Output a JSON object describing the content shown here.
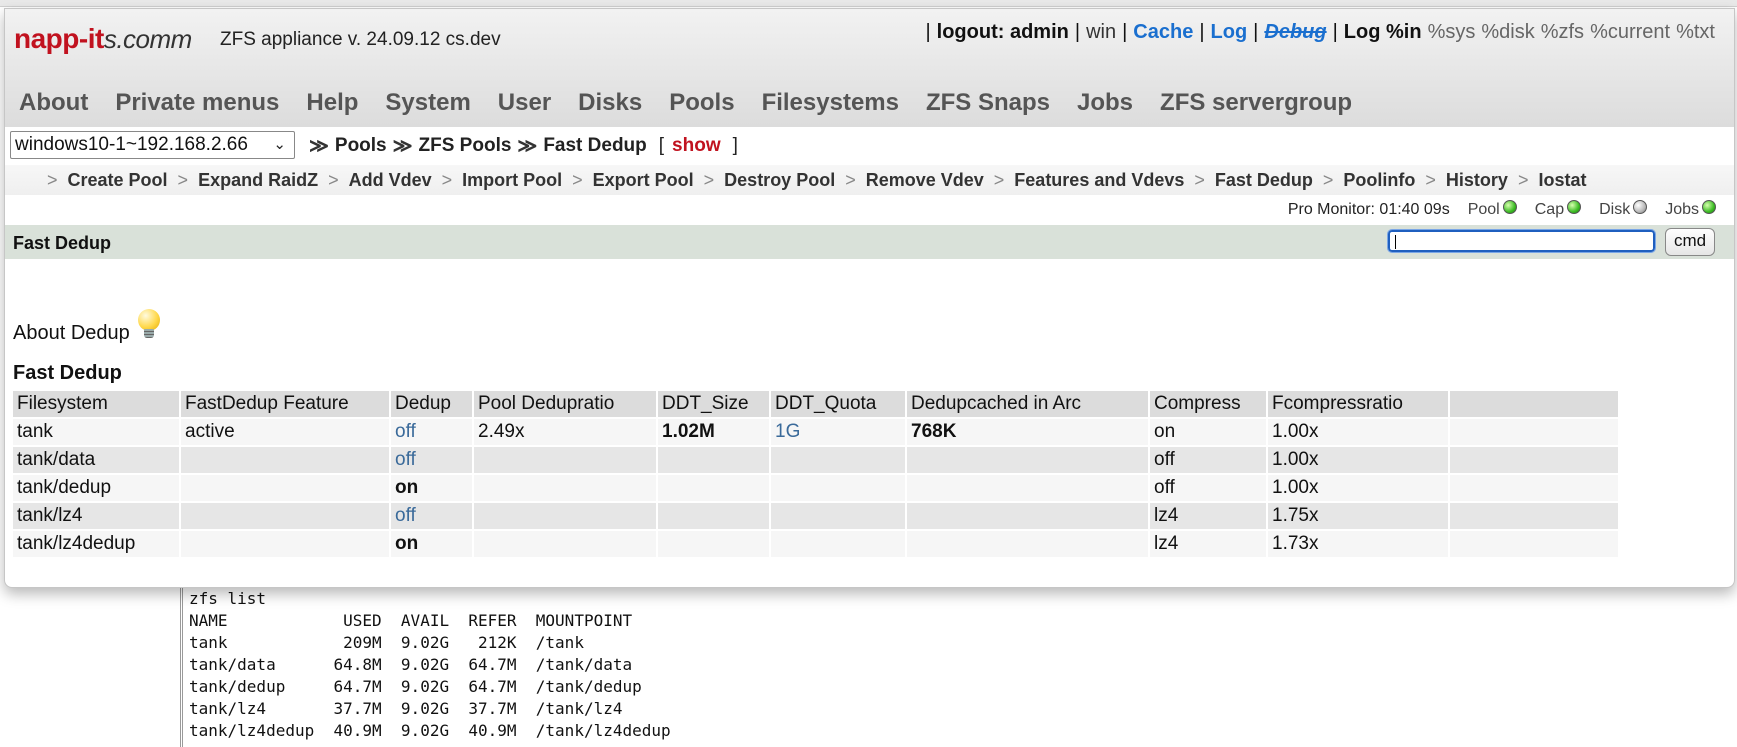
{
  "header": {
    "logo_main": "napp-it",
    "logo_sub": "s.comm",
    "version": "ZFS appliance v. 24.09.12 cs.dev",
    "toplinks": [
      {
        "text": "|",
        "style": "sep"
      },
      {
        "text": "logout: admin",
        "style": "bold"
      },
      {
        "text": "|",
        "style": "sep"
      },
      {
        "text": "win",
        "style": "dark"
      },
      {
        "text": "|",
        "style": "sep"
      },
      {
        "text": "Cache",
        "style": "blue"
      },
      {
        "text": "|",
        "style": "sep"
      },
      {
        "text": "Log",
        "style": "blue"
      },
      {
        "text": "|",
        "style": "sep"
      },
      {
        "text": "Debug",
        "style": "strike"
      },
      {
        "text": "|",
        "style": "sep"
      },
      {
        "text": "Log %in",
        "style": "bold"
      },
      {
        "text": "%sys",
        "style": "grey"
      },
      {
        "text": "%disk",
        "style": "grey"
      },
      {
        "text": "%zfs",
        "style": "grey"
      },
      {
        "text": "%current",
        "style": "grey"
      },
      {
        "text": "%txt",
        "style": "grey"
      }
    ]
  },
  "mainmenu": [
    "About",
    "Private menus",
    "Help",
    "System",
    "User",
    "Disks",
    "Pools",
    "Filesystems",
    "ZFS Snaps",
    "Jobs",
    "ZFS servergroup"
  ],
  "crumbbar": {
    "host": "windows10-1~192.168.2.66",
    "crumbs": [
      "Pools",
      "ZFS Pools",
      "Fast Dedup"
    ],
    "show_label": "show"
  },
  "submenu": [
    "Create Pool",
    "Expand RaidZ",
    "Add Vdev",
    "Import Pool",
    "Export Pool",
    "Destroy Pool",
    "Remove Vdev",
    "Features and Vdevs",
    "Fast Dedup",
    "Poolinfo",
    "History",
    "Iostat"
  ],
  "monitor": {
    "label": "Pro Monitor: 01:40 09s",
    "indicators": [
      {
        "name": "Pool",
        "state": "green"
      },
      {
        "name": "Cap",
        "state": "green"
      },
      {
        "name": "Disk",
        "state": "grey"
      },
      {
        "name": "Jobs",
        "state": "green"
      }
    ]
  },
  "titlebar": {
    "title": "Fast Dedup",
    "cmd_label": "cmd",
    "cmd_value": ""
  },
  "about_label": "About Dedup",
  "table": {
    "title": "Fast Dedup",
    "headers": [
      "Filesystem",
      "FastDedup Feature",
      "Dedup",
      "Pool Dedupratio",
      "DDT_Size",
      "DDT_Quota",
      "Dedupcached in Arc",
      "Compress",
      "Fcompressratio",
      ""
    ],
    "rows": [
      [
        "tank",
        "active",
        "off",
        "2.49x",
        "1.02M",
        "1G",
        "768K",
        "on",
        "1.00x",
        ""
      ],
      [
        "tank/data",
        "",
        "off",
        "",
        "",
        "",
        "",
        "off",
        "1.00x",
        ""
      ],
      [
        "tank/dedup",
        "",
        "on",
        "",
        "",
        "",
        "",
        "off",
        "1.00x",
        ""
      ],
      [
        "tank/lz4",
        "",
        "off",
        "",
        "",
        "",
        "",
        "lz4",
        "1.75x",
        ""
      ],
      [
        "tank/lz4dedup",
        "",
        "on",
        "",
        "",
        "",
        "",
        "lz4",
        "1.73x",
        ""
      ]
    ]
  },
  "console": {
    "command": "zfs list",
    "header": "NAME            USED  AVAIL  REFER  MOUNTPOINT",
    "lines": [
      "tank            209M  9.02G   212K  /tank",
      "tank/data      64.8M  9.02G  64.7M  /tank/data",
      "tank/dedup     64.7M  9.02G  64.7M  /tank/dedup",
      "tank/lz4       37.7M  9.02G  37.7M  /tank/lz4",
      "tank/lz4dedup  40.9M  9.02G  40.9M  /tank/lz4dedup"
    ]
  }
}
